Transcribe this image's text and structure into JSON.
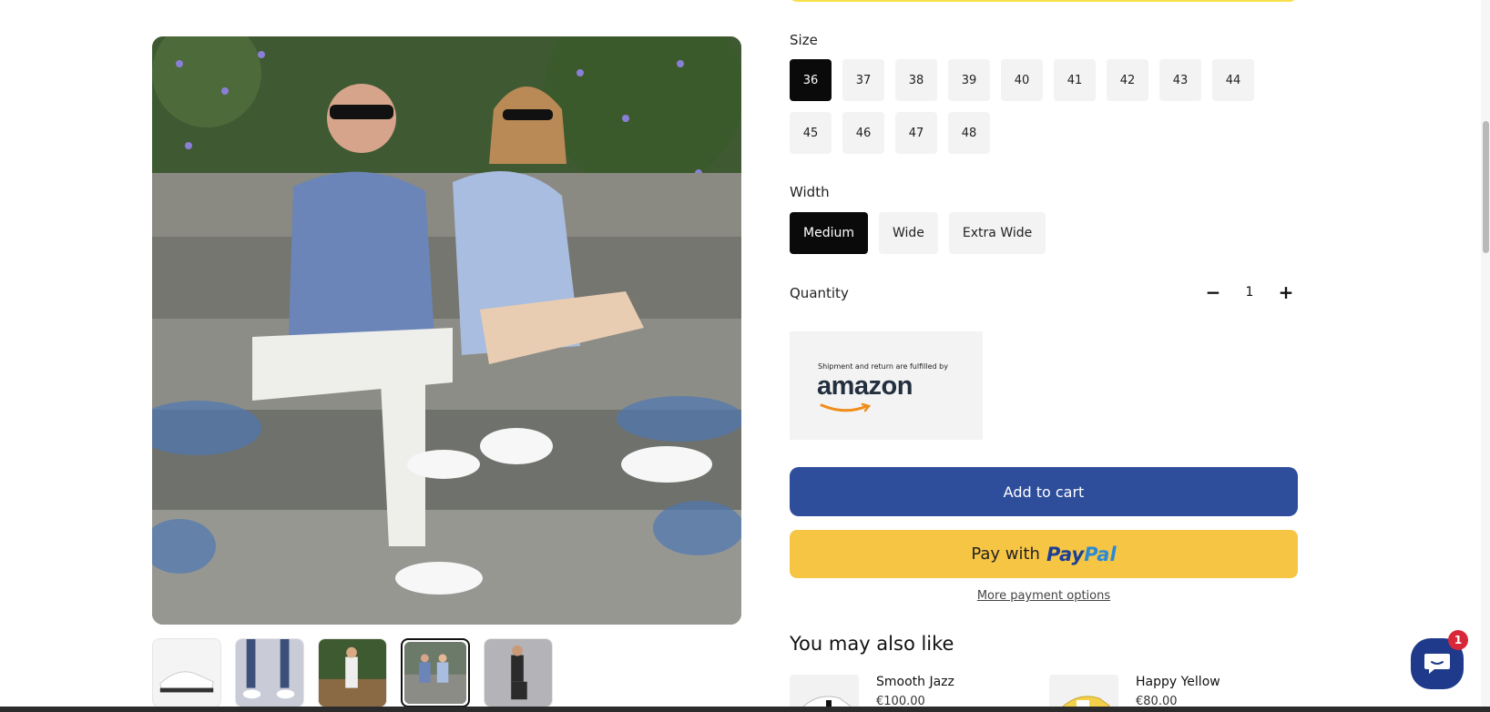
{
  "colors": {
    "selected_option": "#0a0a0a",
    "option_bg": "#f3f3f3",
    "add_to_cart": "#2e4e9c",
    "paypal_button": "#f7c544",
    "chat_button": "#1f3a8a",
    "chat_badge": "#d9273a"
  },
  "size": {
    "label": "Size",
    "selected": "36",
    "options": [
      "36",
      "37",
      "38",
      "39",
      "40",
      "41",
      "42",
      "43",
      "44",
      "45",
      "46",
      "47",
      "48"
    ]
  },
  "width": {
    "label": "Width",
    "selected": "Medium",
    "options": [
      "Medium",
      "Wide",
      "Extra Wide"
    ]
  },
  "quantity": {
    "label": "Quantity",
    "value": "1",
    "minus": "−",
    "plus": "+"
  },
  "amazon": {
    "note": "Shipment and return are fulfilled by",
    "logo_text": "amazon"
  },
  "buttons": {
    "add_to_cart": "Add to cart",
    "paypal_prefix": "Pay with",
    "paypal_brand_a": "Pay",
    "paypal_brand_b": "Pal",
    "more_payment_options": "More payment options"
  },
  "recommendations": {
    "heading": "You may also like",
    "items": [
      {
        "name": "Smooth Jazz",
        "price": "€100.00"
      },
      {
        "name": "Happy Yellow",
        "price": "€80.00"
      }
    ]
  },
  "gallery": {
    "thumbnails": [
      "white-sneaker",
      "walking-legs",
      "woman-on-bridge",
      "couple-on-steps",
      "woman-seated-studio"
    ],
    "active_thumbnail": 3
  },
  "chat": {
    "icon": "chat-bubble-icon",
    "badge_count": "1"
  }
}
